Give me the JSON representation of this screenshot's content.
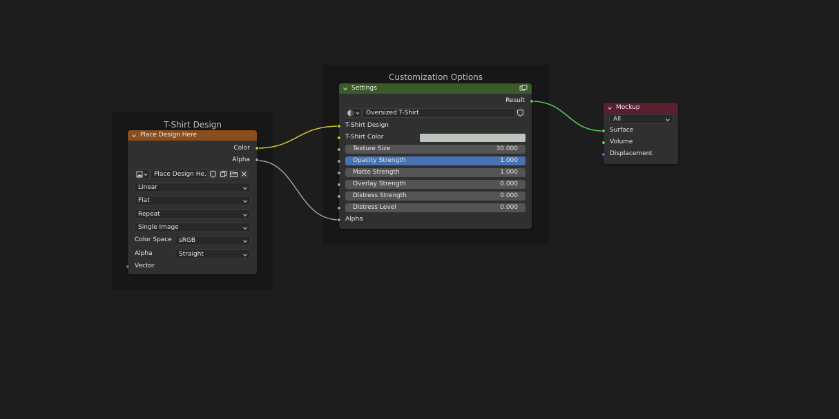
{
  "frames": {
    "tshirt_design": {
      "title": "T-Shirt Design"
    },
    "customization": {
      "title": "Customization Options"
    }
  },
  "image_node": {
    "header": "Place Design Here",
    "header_color": "#8a4e1e",
    "outputs": [
      "Color",
      "Alpha"
    ],
    "image_name": "Place Design He...",
    "interpolation": "Linear",
    "projection": "Flat",
    "extension": "Repeat",
    "source": "Single Image",
    "color_space_label": "Color Space",
    "color_space": "sRGB",
    "alpha_label": "Alpha",
    "alpha_mode": "Straight",
    "input_vector": "Vector"
  },
  "settings_node": {
    "header": "Settings",
    "header_color": "#3a5a2a",
    "output_result": "Result",
    "material": "Oversized T-Shirt",
    "input_design": "T-Shirt Design",
    "input_color": "T-Shirt Color",
    "tshirt_color_value": "#bcc4bd",
    "sliders": [
      {
        "label": "Texture Size",
        "value": "30.000",
        "active": false
      },
      {
        "label": "Opacity Strength",
        "value": "1.000",
        "active": true
      },
      {
        "label": "Matte Strength",
        "value": "1.000",
        "active": false
      },
      {
        "label": "Overlay Strength",
        "value": "0.000",
        "active": false
      },
      {
        "label": "Distress Strength",
        "value": "0.000",
        "active": false
      },
      {
        "label": "Distress Level",
        "value": "0.000",
        "active": false
      }
    ],
    "input_alpha": "Alpha"
  },
  "mockup_node": {
    "header": "Mockup",
    "header_color": "#5a2030",
    "target": "All",
    "inputs": [
      "Surface",
      "Volume",
      "Displacement"
    ]
  },
  "colors": {
    "socket_color": "#c7c729",
    "socket_float": "#a1a1a1",
    "socket_shader": "#63c763",
    "socket_vector": "#6363c7",
    "wire_color": "#c9c33a",
    "wire_alpha": "#a8a8a8",
    "wire_shader": "#5cc45c"
  }
}
